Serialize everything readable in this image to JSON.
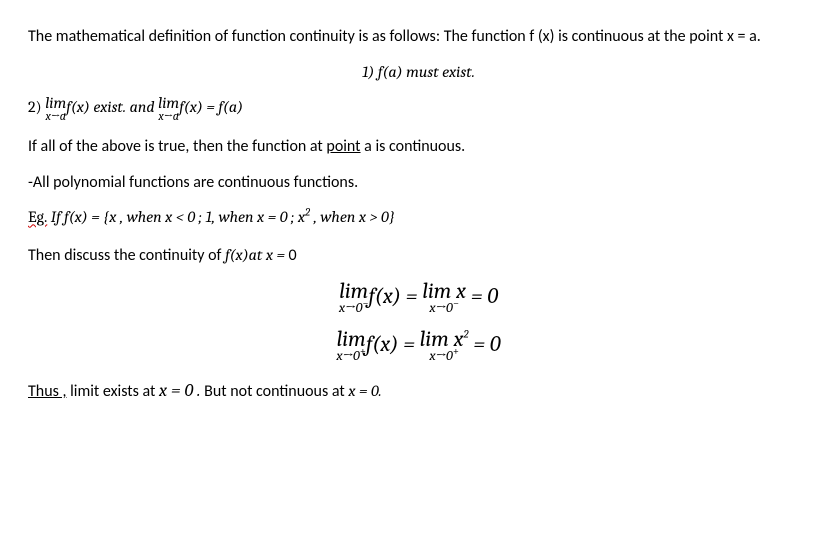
{
  "p1_a": "The mathematical definition of function continuity is as follows: The function f (x) is continuous at the point x = a.",
  "cond1": "1) f(a) must exist.",
  "cond2_prefix": "2) ",
  "lim": "lim",
  "xa": "x→a",
  "fx": "f(x)",
  "cond2_mid1": " exist. and ",
  "eq_fa": " = f(a)",
  "p3_a": "If all of the above is true, then the function at ",
  "p3_point": "point",
  "p3_b": " a is continuous.",
  "p4": "-All polynomial functions are continuous functions.",
  "eg_label": "Eg.",
  "eg_body": " If f(x) = {x , when x < 0   ;    1, when x = 0    ;    x",
  "eg_body2": " , when x > 0}",
  "sq": "2",
  "p6": "Then discuss the continuity of f(x)at x = 0",
  "x0m": "x→0",
  "minus": "−",
  "plus": "+",
  "limx": " lim x",
  "eqsp": "  =  ",
  "zero": " = 0",
  "limx2a": " lim x",
  "thus": "Thus ,",
  "th_a": " limit exists at ",
  "xeq0": "x  = 0 .",
  "th_b": " But not continuous at ",
  "th_c": "x  = 0."
}
